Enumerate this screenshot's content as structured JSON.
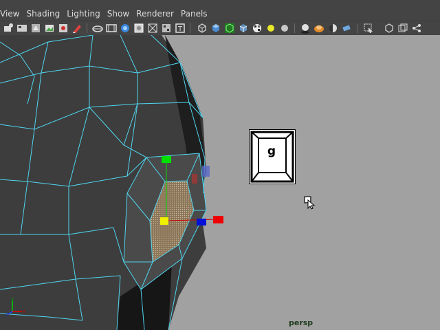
{
  "menu": {
    "items": [
      {
        "label": "View"
      },
      {
        "label": "Shading"
      },
      {
        "label": "Lighting"
      },
      {
        "label": "Show"
      },
      {
        "label": "Renderer"
      },
      {
        "label": "Panels"
      }
    ]
  },
  "keyboard_hint": {
    "key": "g"
  },
  "viewport": {
    "camera_label": "persp"
  },
  "axis": {
    "x": "x",
    "y": "y",
    "z": "z"
  },
  "colors": {
    "wireframe": "#4fd6f0",
    "mesh_fill": "#3c3c3c",
    "viewport_bg": "#a1a1a1",
    "handle_green": "#00e000",
    "handle_red": "#ee0000",
    "handle_blue": "#0010d8",
    "handle_yellow": "#f0f000"
  }
}
